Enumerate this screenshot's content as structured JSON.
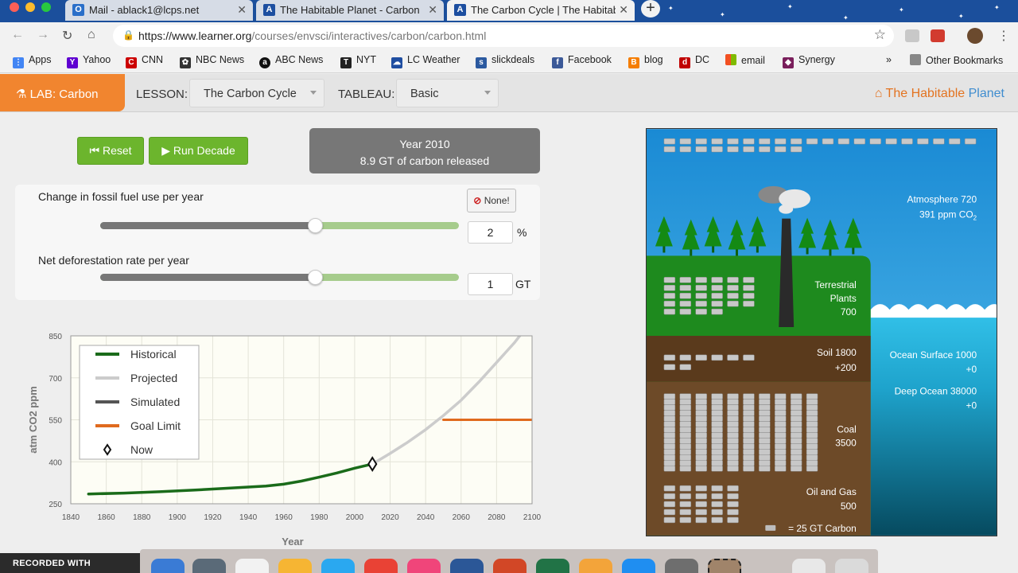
{
  "browser": {
    "tabs": [
      {
        "title": "Mail - ablack1@lcps.net",
        "icon": "mail-icon"
      },
      {
        "title": "The Habitable Planet - Carbon",
        "icon": "learner-icon"
      },
      {
        "title": "The Carbon Cycle | The Habitable",
        "icon": "learner-icon"
      }
    ],
    "url_host": "https://www.learner.org",
    "url_path": "/courses/envsci/interactives/carbon/carbon.html",
    "bookmarks": [
      {
        "label": "Apps",
        "color": "#4285f4"
      },
      {
        "label": "Yahoo",
        "color": "#5f01d1"
      },
      {
        "label": "CNN",
        "color": "#cc0000"
      },
      {
        "label": "NBC News",
        "color": "#333333"
      },
      {
        "label": "ABC News",
        "color": "#111111"
      },
      {
        "label": "NYT",
        "color": "#222222"
      },
      {
        "label": "LC Weather",
        "color": "#1f4ea1"
      },
      {
        "label": "slickdeals",
        "color": "#2c5aa0"
      },
      {
        "label": "Facebook",
        "color": "#3b5998"
      },
      {
        "label": "blog",
        "color": "#f57d00"
      },
      {
        "label": "DC",
        "color": "#c00000"
      },
      {
        "label": "email",
        "color": "#f25022"
      },
      {
        "label": "Synergy",
        "color": "#7a1f5c"
      }
    ],
    "more_bookmarks": "»",
    "other_bookmarks": "Other Bookmarks"
  },
  "lab": {
    "tab_label": "LAB: Carbon",
    "lesson_label": "LESSON:",
    "lesson_value": "The Carbon Cycle",
    "tableau_label": "TABLEAU:",
    "tableau_value": "Basic",
    "brand_part1": "The Habitable",
    "brand_part2": "Planet"
  },
  "controls": {
    "reset_label": "Reset",
    "run_label": "Run Decade",
    "year_line": "Year 2010",
    "released_line": "8.9 GT of carbon released",
    "none_label": "None!",
    "fossil": {
      "label": "Change in fossil fuel use per year",
      "value": "2",
      "unit": "%",
      "position": 0.6
    },
    "deforestation": {
      "label": "Net deforestation rate per year",
      "value": "1",
      "unit": "GT",
      "position": 0.6
    }
  },
  "chart_data": {
    "type": "line",
    "ylabel": "atm CO2 ppm",
    "xlabel": "Year",
    "xlim": [
      1840,
      2100
    ],
    "ylim": [
      250,
      850
    ],
    "x_ticks": [
      1840,
      1860,
      1880,
      1900,
      1920,
      1940,
      1960,
      1980,
      2000,
      2020,
      2040,
      2060,
      2080,
      2100
    ],
    "y_ticks": [
      250,
      400,
      550,
      700,
      850
    ],
    "grid": true,
    "legend_position": "top-left",
    "legend": [
      "Historical",
      "Projected",
      "Simulated",
      "Goal Limit",
      "Now"
    ],
    "series": [
      {
        "name": "Historical",
        "color": "#1a6b1a",
        "x": [
          1850,
          1870,
          1890,
          1910,
          1930,
          1950,
          1960,
          1970,
          1980,
          1990,
          2000,
          2010
        ],
        "y": [
          285,
          288,
          293,
          299,
          306,
          313,
          320,
          331,
          345,
          360,
          377,
          392
        ]
      },
      {
        "name": "Projected",
        "color": "#cccccc",
        "x": [
          2010,
          2020,
          2030,
          2040,
          2050,
          2060,
          2070,
          2080,
          2090,
          2097
        ],
        "y": [
          392,
          430,
          470,
          515,
          565,
          620,
          685,
          755,
          825,
          882
        ]
      },
      {
        "name": "Goal Limit",
        "color": "#e06a1e",
        "x": [
          2050,
          2100
        ],
        "y": [
          550,
          550
        ]
      }
    ],
    "now_marker": {
      "x": 2010,
      "y": 392
    }
  },
  "panel": {
    "atmosphere_label": "Atmosphere 720",
    "atmosphere_ppm": "391 ppm CO",
    "atmosphere_sub": "2",
    "plants_line1": "Terrestrial",
    "plants_line2": "Plants",
    "plants_value": "700",
    "soil_label": "Soil 1800",
    "soil_change": "+200",
    "ocean_surface_label": "Ocean Surface 1000",
    "ocean_surface_change": "+0",
    "deep_ocean_label": "Deep Ocean 38000",
    "deep_ocean_change": "+0",
    "coal_label": "Coal",
    "coal_value": "3500",
    "oil_label": "Oil and Gas",
    "oil_value": "500",
    "legend_label": "= 25 GT Carbon",
    "colors": {
      "sky": "#2a9de0",
      "land": "#1f8a1f",
      "soil": "#5b3a1e",
      "ocean": "#2bb7e3",
      "deep": "#0d6f8f"
    }
  },
  "recording": {
    "label": "RECORDED WITH"
  }
}
